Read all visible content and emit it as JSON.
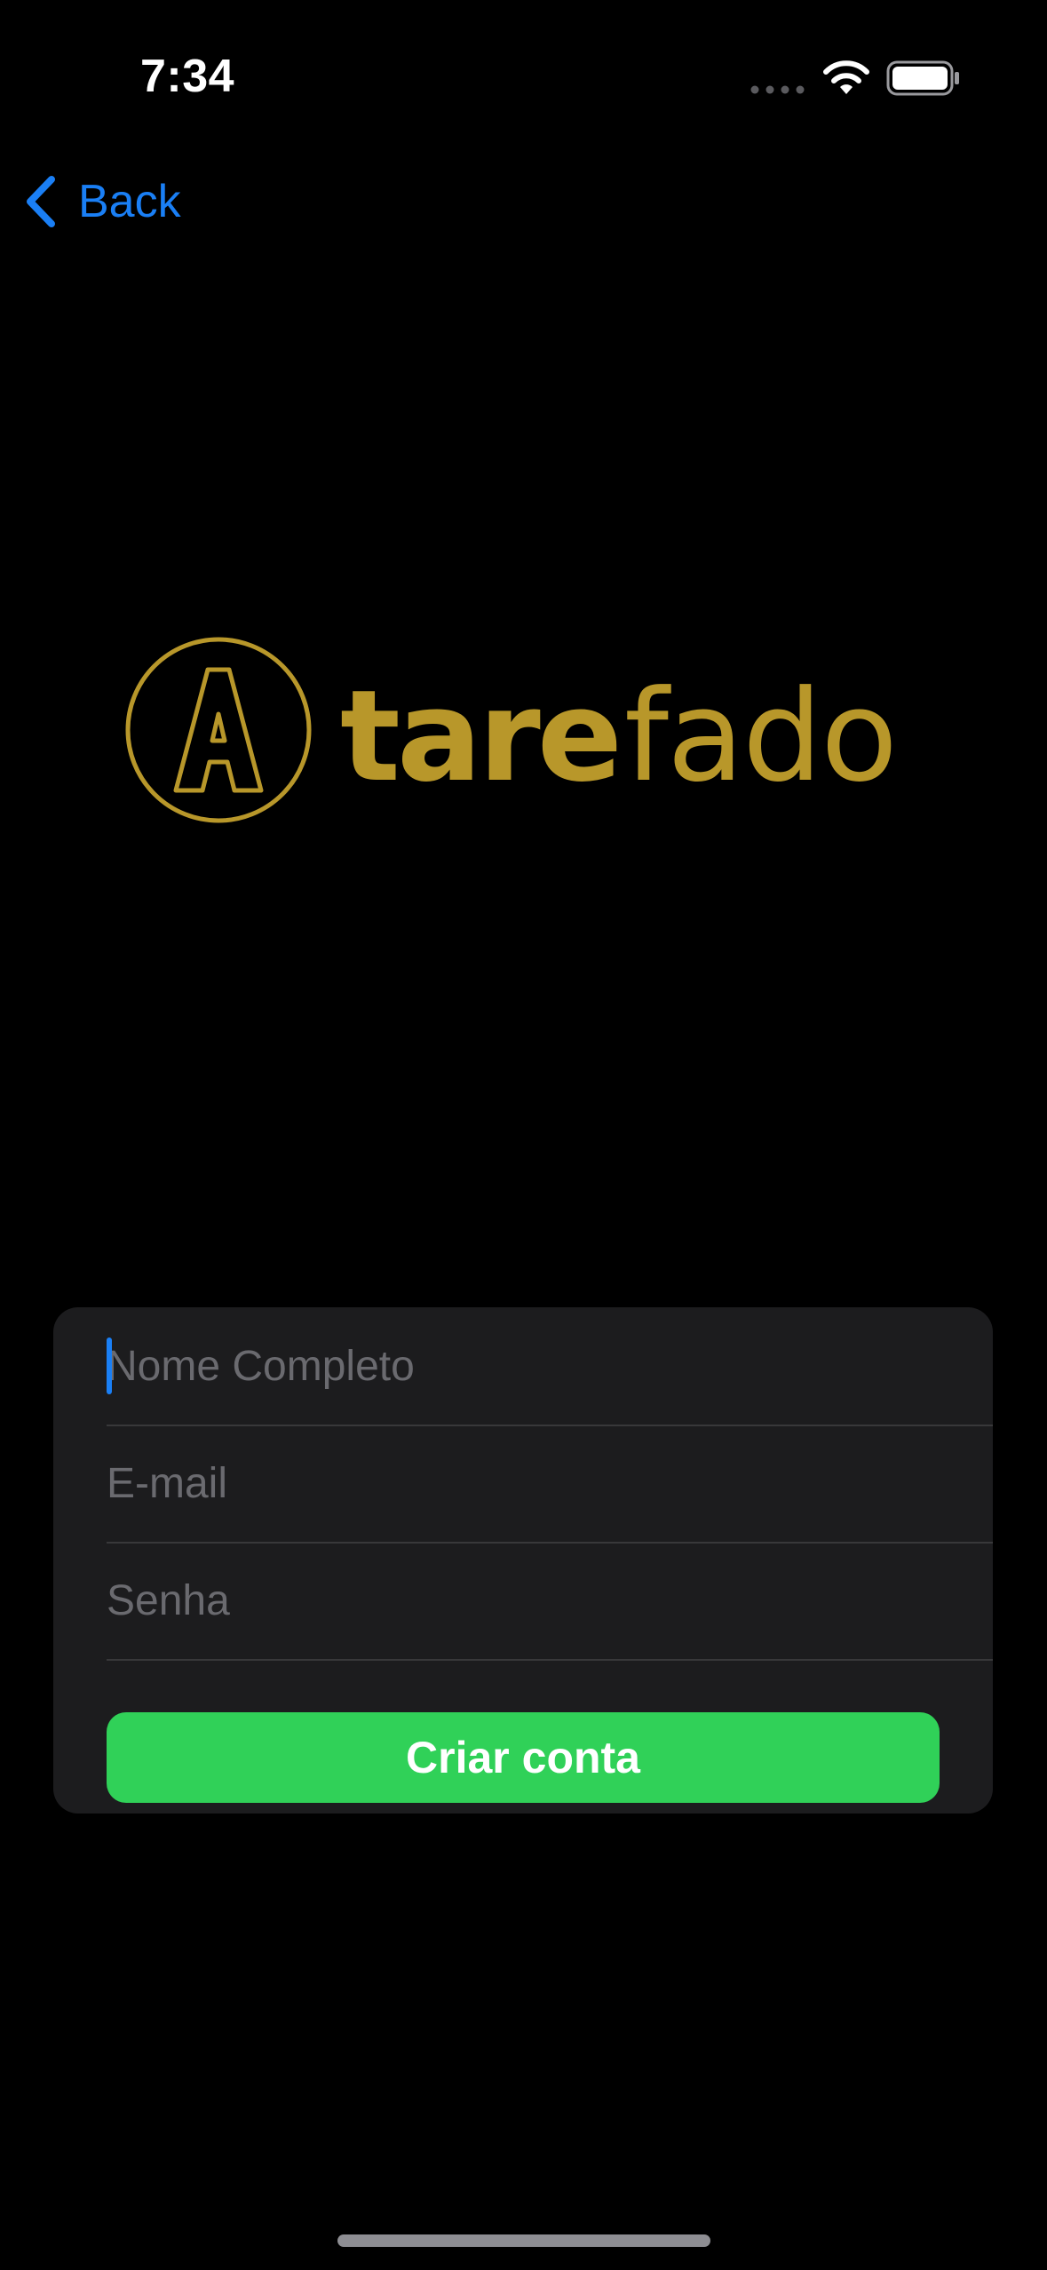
{
  "status_bar": {
    "time": "7:34",
    "icons": [
      "signal-dots-icon",
      "wifi-icon",
      "battery-icon"
    ]
  },
  "nav": {
    "back_label": "Back",
    "back_icon": "chevron-left-icon"
  },
  "logo": {
    "text": "Atarefado",
    "color": "#b8972a"
  },
  "form": {
    "fields": [
      {
        "name": "full-name",
        "placeholder": "Nome Completo",
        "value": ""
      },
      {
        "name": "email",
        "placeholder": "E-mail",
        "value": ""
      },
      {
        "name": "password",
        "placeholder": "Senha",
        "value": ""
      }
    ],
    "submit_label": "Criar conta"
  },
  "colors": {
    "accent": "#1a7ff5",
    "button": "#30d158",
    "card": "#1c1c1e",
    "background": "#000000"
  }
}
